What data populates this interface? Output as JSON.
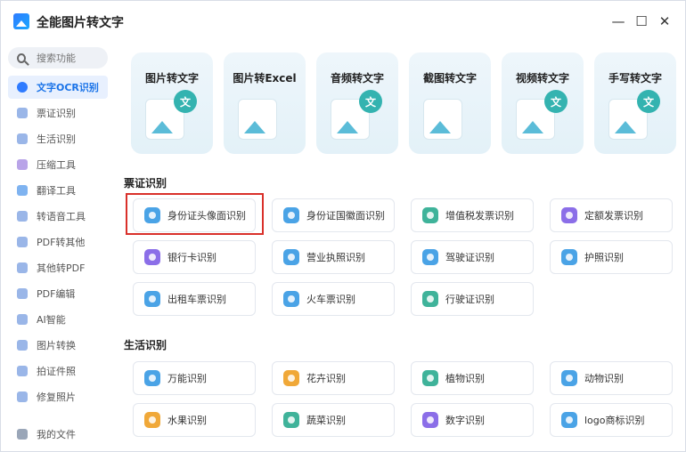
{
  "app": {
    "title": "全能图片转文字"
  },
  "window_controls": {
    "minimize": "—",
    "maximize": "☐",
    "close": "✕"
  },
  "sidebar": {
    "search_placeholder": "搜索功能",
    "items": [
      {
        "label": "文字OCR识别",
        "icon": "ocr-icon",
        "color": "#2f7bff",
        "active": true
      },
      {
        "label": "票证识别",
        "icon": "ticket-icon",
        "color": "#9ab6e8"
      },
      {
        "label": "生活识别",
        "icon": "leaf-icon",
        "color": "#9ab6e8"
      },
      {
        "label": "压缩工具",
        "icon": "compress-icon",
        "color": "#b9a4e8"
      },
      {
        "label": "翻译工具",
        "icon": "translate-icon",
        "color": "#7fb3f0"
      },
      {
        "label": "转语音工具",
        "icon": "voice-icon",
        "color": "#9ab6e8"
      },
      {
        "label": "PDF转其他",
        "icon": "pdf-icon",
        "color": "#9ab6e8"
      },
      {
        "label": "其他转PDF",
        "icon": "pdf2-icon",
        "color": "#9ab6e8"
      },
      {
        "label": "PDF编辑",
        "icon": "pdf-edit-icon",
        "color": "#9ab6e8"
      },
      {
        "label": "AI智能",
        "icon": "ai-icon",
        "color": "#9ab6e8"
      },
      {
        "label": "图片转换",
        "icon": "image-convert-icon",
        "color": "#9ab6e8"
      },
      {
        "label": "拍证件照",
        "icon": "camera-icon",
        "color": "#9ab6e8"
      },
      {
        "label": "修复照片",
        "icon": "repair-icon",
        "color": "#9ab6e8"
      }
    ],
    "my_files": "我的文件"
  },
  "features": [
    {
      "label": "图片转文字",
      "badge": "文"
    },
    {
      "label": "图片转Excel",
      "badge": ""
    },
    {
      "label": "音频转文字",
      "badge": "文"
    },
    {
      "label": "截图转文字",
      "badge": ""
    },
    {
      "label": "视频转文字",
      "badge": "文"
    },
    {
      "label": "手写转文字",
      "badge": "文"
    }
  ],
  "sections": [
    {
      "title": "票证识别",
      "tools": [
        {
          "label": "身份证头像面识别",
          "color": "#4aa3e6"
        },
        {
          "label": "身份证国徽面识别",
          "color": "#4aa3e6"
        },
        {
          "label": "增值税发票识别",
          "color": "#3fb39a"
        },
        {
          "label": "定额发票识别",
          "color": "#8b6ee8"
        },
        {
          "label": "银行卡识别",
          "color": "#8b6ee8"
        },
        {
          "label": "营业执照识别",
          "color": "#4aa3e6"
        },
        {
          "label": "驾驶证识别",
          "color": "#4aa3e6"
        },
        {
          "label": "护照识别",
          "color": "#4aa3e6"
        },
        {
          "label": "出租车票识别",
          "color": "#4aa3e6"
        },
        {
          "label": "火车票识别",
          "color": "#4aa3e6"
        },
        {
          "label": "行驶证识别",
          "color": "#3fb39a"
        }
      ]
    },
    {
      "title": "生活识别",
      "tools": [
        {
          "label": "万能识别",
          "color": "#4aa3e6"
        },
        {
          "label": "花卉识别",
          "color": "#f0a838"
        },
        {
          "label": "植物识别",
          "color": "#3fb39a"
        },
        {
          "label": "动物识别",
          "color": "#4aa3e6"
        },
        {
          "label": "水果识别",
          "color": "#f0a838"
        },
        {
          "label": "蔬菜识别",
          "color": "#3fb39a"
        },
        {
          "label": "数字识别",
          "color": "#8b6ee8"
        },
        {
          "label": "logo商标识别",
          "color": "#4aa3e6"
        }
      ]
    }
  ]
}
